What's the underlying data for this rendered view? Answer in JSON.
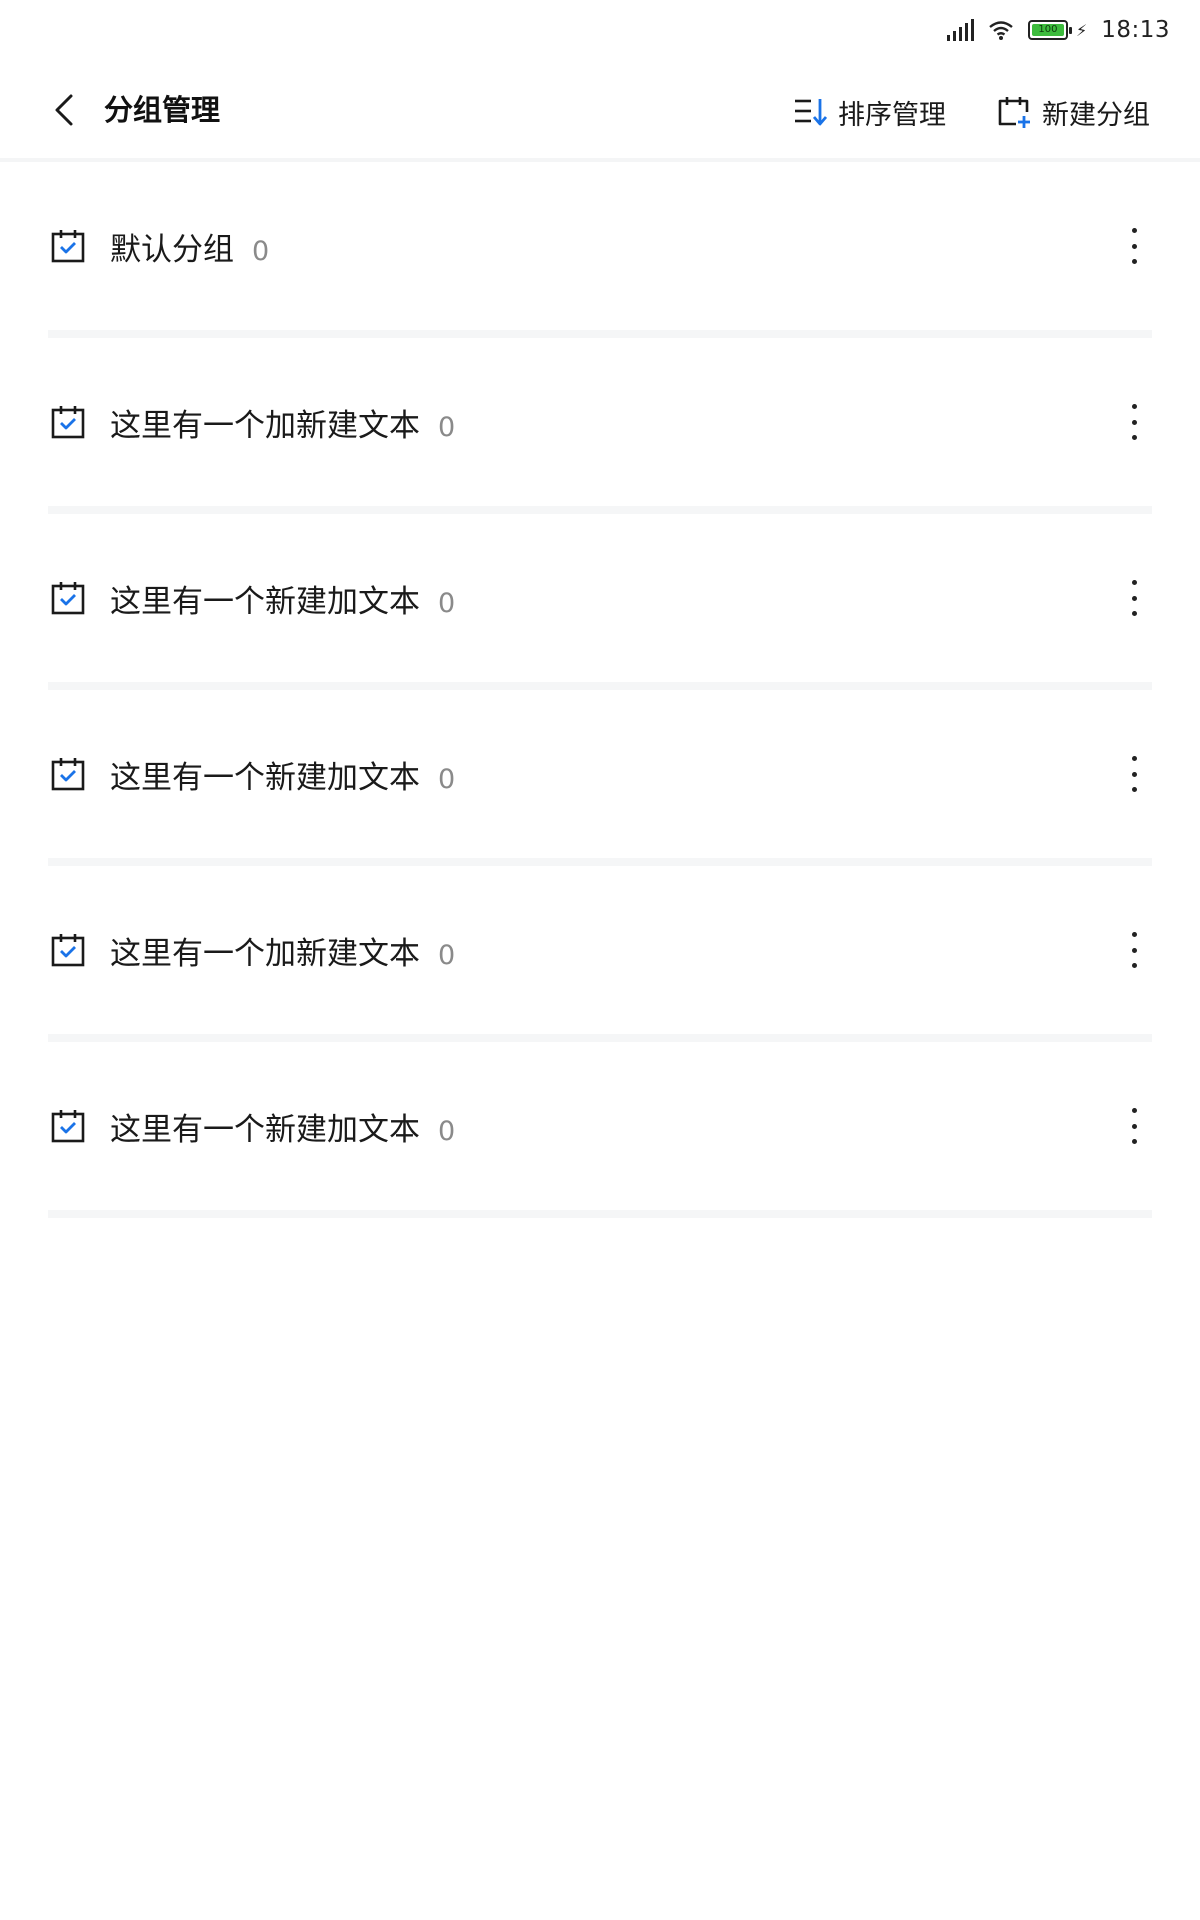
{
  "status_bar": {
    "time": "18:13",
    "battery": "100"
  },
  "header": {
    "title": "分组管理",
    "sort_label": "排序管理",
    "new_group_label": "新建分组"
  },
  "groups": [
    {
      "name": "默认分组",
      "count": "0"
    },
    {
      "name": "这里有一个加新建文本",
      "count": "0"
    },
    {
      "name": "这里有一个新建加文本",
      "count": "0"
    },
    {
      "name": "这里有一个新建加文本",
      "count": "0"
    },
    {
      "name": "这里有一个加新建文本",
      "count": "0"
    },
    {
      "name": "这里有一个新建加文本",
      "count": "0"
    }
  ],
  "colors": {
    "accent": "#1a73e8",
    "divider": "#f5f6f7"
  },
  "icons": {
    "back": "chevron-left-icon",
    "sort": "sort-list-icon",
    "new_group": "calendar-add-icon",
    "group": "calendar-check-icon",
    "more": "more-vertical-icon"
  }
}
